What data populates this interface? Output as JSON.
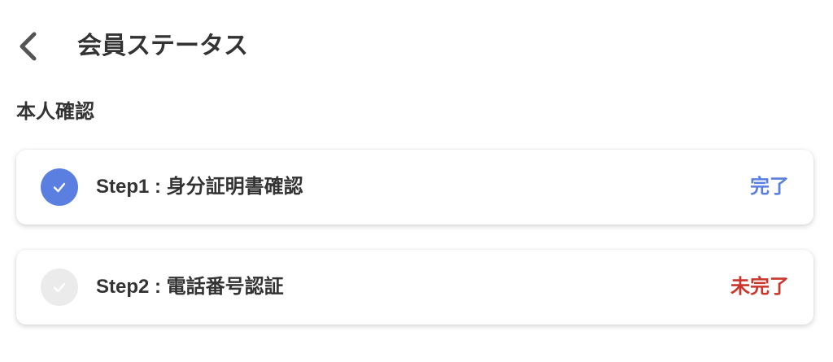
{
  "header": {
    "back_icon": "chevron-left-icon",
    "title": "会員ステータス"
  },
  "section": {
    "title": "本人確認"
  },
  "colors": {
    "text": "#333333",
    "back_icon": "#555555"
  },
  "steps": [
    {
      "label": "Step1 : 身分証明書確認",
      "status": "完了",
      "completed": true,
      "icon": "check-circle-icon",
      "circle_color": "#5b7fe0",
      "status_color": "#5b7fe0"
    },
    {
      "label": "Step2 : 電話番号認証",
      "status": "未完了",
      "completed": false,
      "icon": "check-circle-icon",
      "circle_color": "#ebebeb",
      "status_color": "#c9372c"
    }
  ]
}
